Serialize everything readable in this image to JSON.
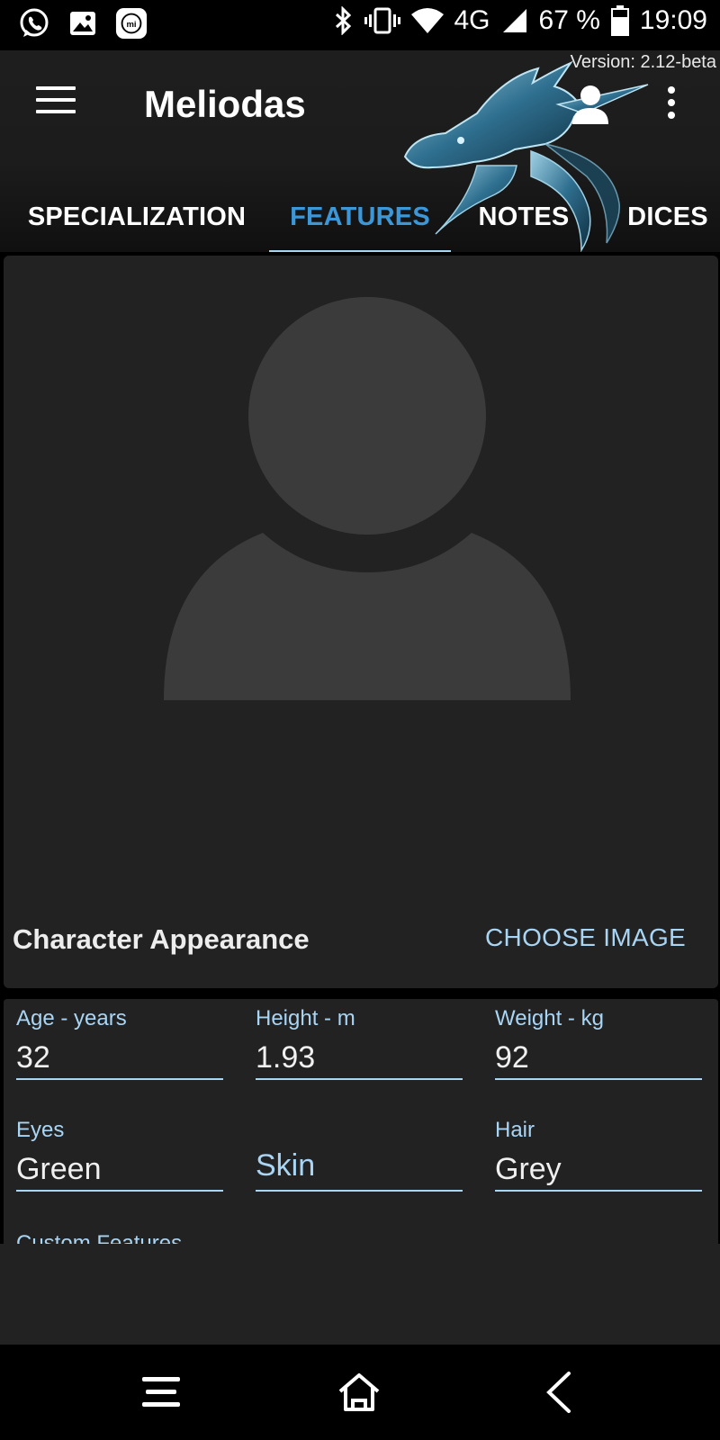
{
  "status_bar": {
    "left_icons": [
      "whatsapp-icon",
      "gallery-icon",
      "mi-icon"
    ],
    "right_icons": [
      "bluetooth-icon",
      "vibrate-icon",
      "wifi-icon",
      "signal-icon",
      "battery-icon"
    ],
    "network": "4G",
    "battery": "67 %",
    "time": "19:09"
  },
  "app_bar": {
    "version": "Version: 2.12-beta",
    "title": "Meliodas",
    "icons": [
      "menu-icon",
      "dragon-logo",
      "profile-icon",
      "more-icon"
    ]
  },
  "tabs": [
    {
      "label": "SPECIALIZATION",
      "active": false
    },
    {
      "label": "FEATURES",
      "active": true
    },
    {
      "label": "NOTES",
      "active": false
    },
    {
      "label": "DICES",
      "active": false
    }
  ],
  "appearance": {
    "placeholder_icon": "person-placeholder-icon",
    "title": "Character Appearance",
    "choose_label": "CHOOSE IMAGE"
  },
  "fields": {
    "age": {
      "label": "Age - years",
      "value": "32"
    },
    "height": {
      "label": "Height - m",
      "value": "1.93"
    },
    "weight": {
      "label": "Weight - kg",
      "value": "92"
    },
    "eyes": {
      "label": "Eyes",
      "value": "Green"
    },
    "skin": {
      "placeholder": "Skin"
    },
    "hair": {
      "label": "Hair",
      "value": "Grey"
    },
    "custom_label": "Custom Features"
  },
  "nav_bar": {
    "icons": [
      "recents-icon",
      "home-icon",
      "back-icon"
    ]
  },
  "colors": {
    "accent": "#3c97d8",
    "accent_light": "#a9d5f5",
    "card": "#222222",
    "background": "#000000"
  }
}
